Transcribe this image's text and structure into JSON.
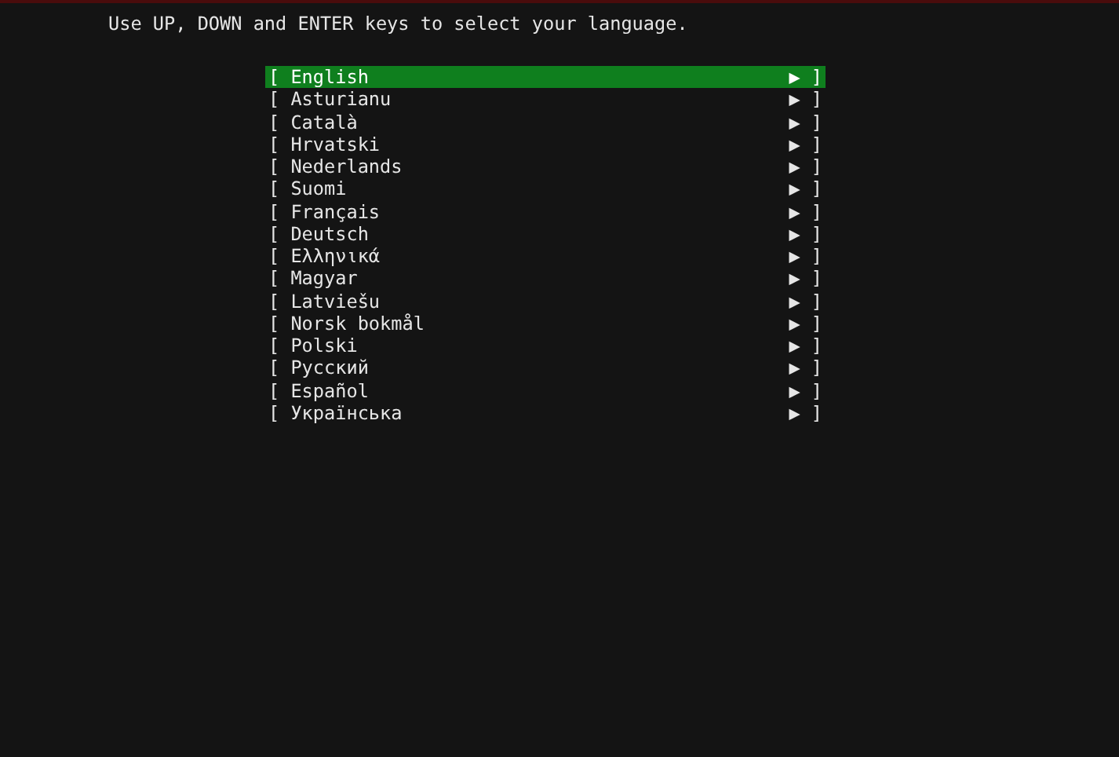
{
  "instruction": "Use UP, DOWN and ENTER keys to select your language.",
  "languages": [
    {
      "left": "[",
      "label": "English",
      "arrow": "▶",
      "right": "]",
      "selected": true
    },
    {
      "left": "[",
      "label": "Asturianu",
      "arrow": "▶",
      "right": "]",
      "selected": false
    },
    {
      "left": "[",
      "label": "Català",
      "arrow": "▶",
      "right": "]",
      "selected": false
    },
    {
      "left": "[",
      "label": "Hrvatski",
      "arrow": "▶",
      "right": "]",
      "selected": false
    },
    {
      "left": "[",
      "label": "Nederlands",
      "arrow": "▶",
      "right": "]",
      "selected": false
    },
    {
      "left": "[",
      "label": "Suomi",
      "arrow": "▶",
      "right": "]",
      "selected": false
    },
    {
      "left": "[",
      "label": "Français",
      "arrow": "▶",
      "right": "]",
      "selected": false
    },
    {
      "left": "[",
      "label": "Deutsch",
      "arrow": "▶",
      "right": "]",
      "selected": false
    },
    {
      "left": "[",
      "label": "Ελληνικά",
      "arrow": "▶",
      "right": "]",
      "selected": false
    },
    {
      "left": "[",
      "label": "Magyar",
      "arrow": "▶",
      "right": "]",
      "selected": false
    },
    {
      "left": "[",
      "label": "Latviešu",
      "arrow": "▶",
      "right": "]",
      "selected": false
    },
    {
      "left": "[",
      "label": "Norsk bokmål",
      "arrow": "▶",
      "right": "]",
      "selected": false
    },
    {
      "left": "[",
      "label": "Polski",
      "arrow": "▶",
      "right": "]",
      "selected": false
    },
    {
      "left": "[",
      "label": "Русский",
      "arrow": "▶",
      "right": "]",
      "selected": false
    },
    {
      "left": "[",
      "label": "Español",
      "arrow": "▶",
      "right": "]",
      "selected": false
    },
    {
      "left": "[",
      "label": "Українська",
      "arrow": "▶",
      "right": "]",
      "selected": false
    }
  ]
}
